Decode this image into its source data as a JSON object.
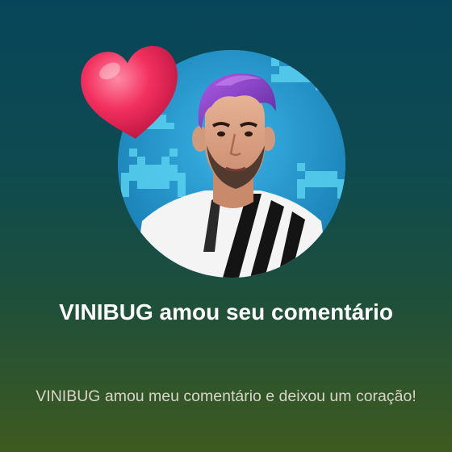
{
  "notification": {
    "title": "VINIBUG amou seu comentário",
    "message": "VINIBUG amou meu comentário e deixou um coração!"
  },
  "icons": {
    "badge": "heart-icon"
  },
  "colors": {
    "heart": "#f2305f",
    "avatar_background": "#1b8fc4",
    "hair": "#8a3fd1"
  }
}
